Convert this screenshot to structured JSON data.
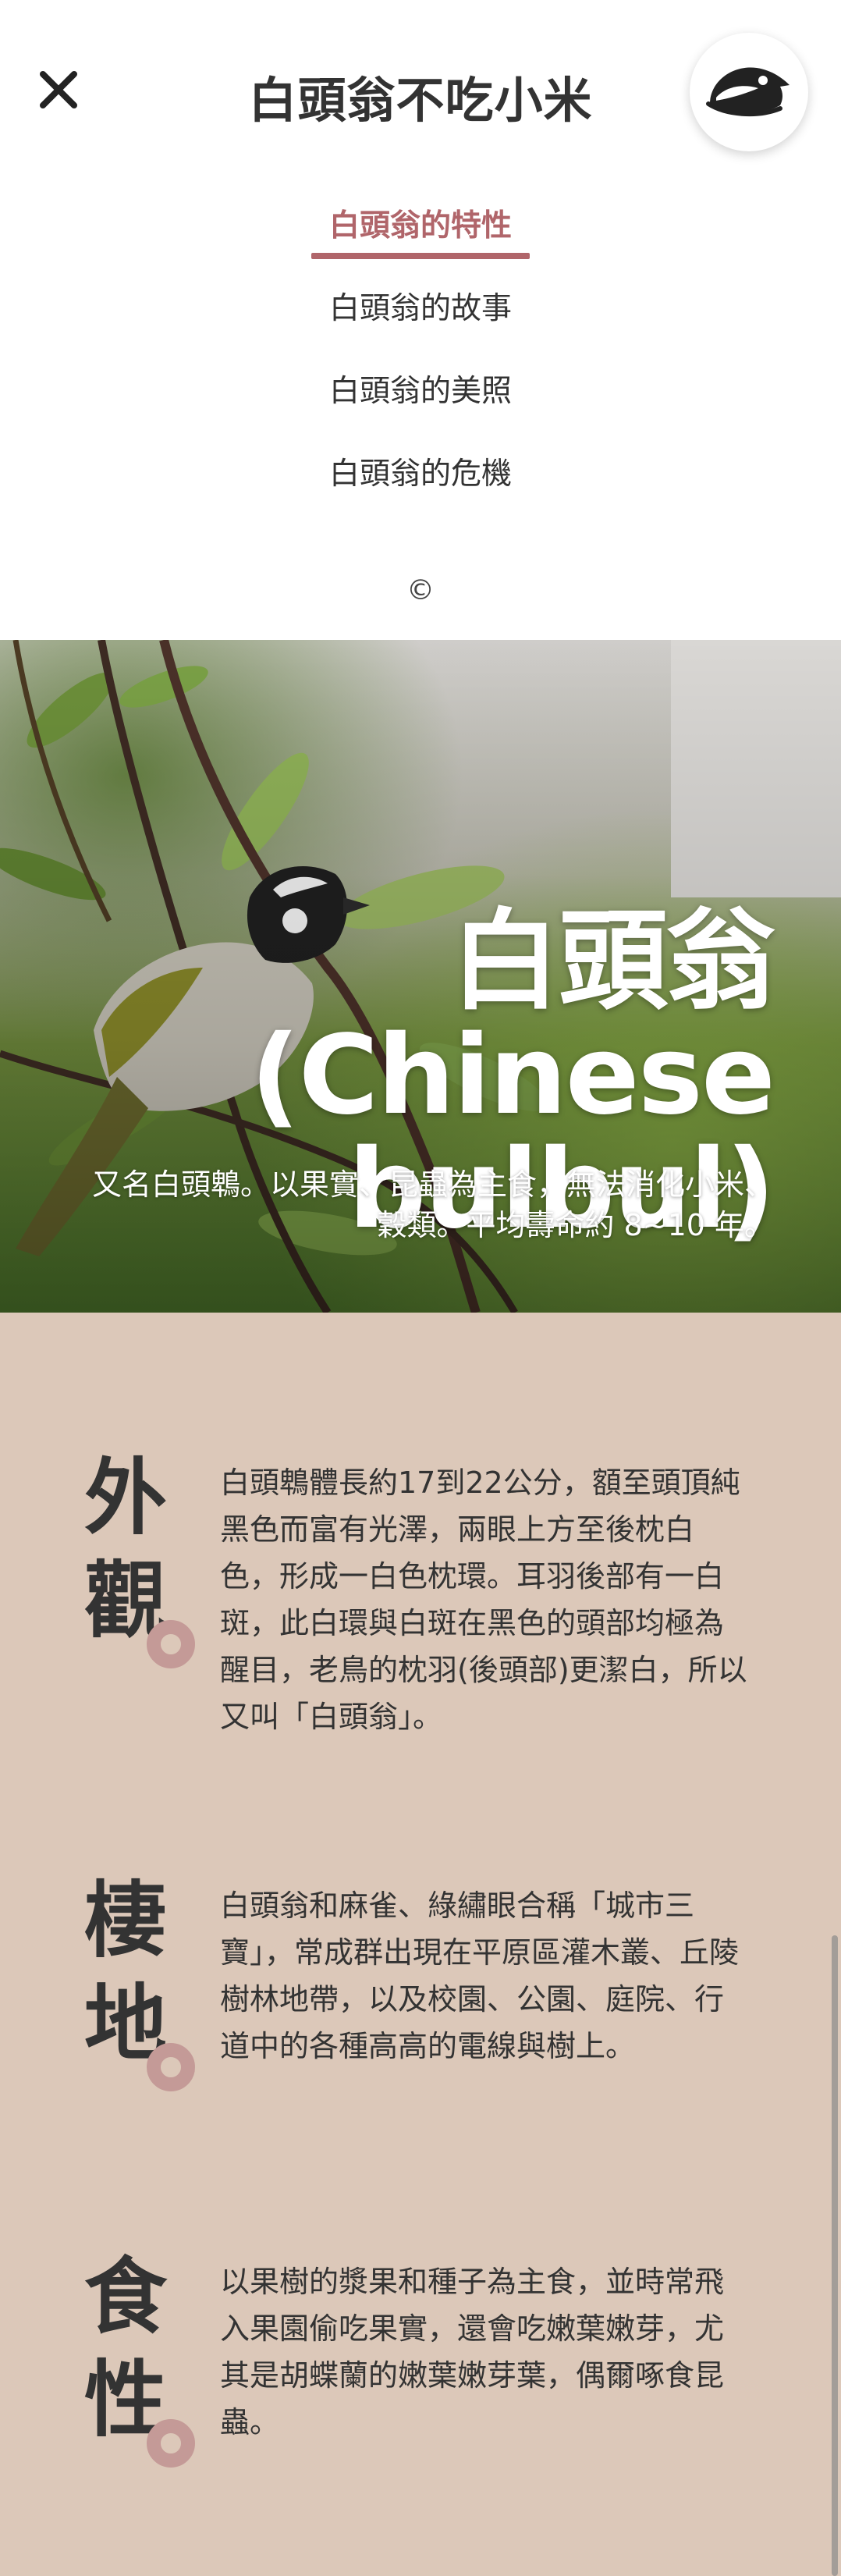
{
  "header": {
    "title": "白頭翁不吃小米",
    "close_icon": "close-icon",
    "logo_icon": "bird-logo-icon"
  },
  "nav": {
    "items": [
      {
        "label": "白頭翁的特性",
        "active": true
      },
      {
        "label": "白頭翁的故事",
        "active": false
      },
      {
        "label": "白頭翁的美照",
        "active": false
      },
      {
        "label": "白頭翁的危機",
        "active": false
      }
    ],
    "copyright": "©"
  },
  "hero": {
    "title": "白頭翁(Chinese bulbul)",
    "subtitle": "又名白頭鵯。以果實、昆蟲為主食，無法消化小米、穀類。平均壽命約 8~10 年。"
  },
  "sections": [
    {
      "heading": [
        "外",
        "觀"
      ],
      "body": "白頭鵯體長約17到22公分，額至頭頂純黑色而富有光澤，兩眼上方至後枕白色，形成一白色枕環。耳羽後部有一白斑，此白環與白斑在黑色的頭部均極為醒目，老鳥的枕羽(後頭部)更潔白，所以又叫「白頭翁」。"
    },
    {
      "heading": [
        "棲",
        "地"
      ],
      "body": "白頭翁和麻雀、綠繡眼合稱「城市三寶」，常成群出現在平原區灌木叢、丘陵樹林地帶，以及校園、公園、庭院、行道中的各種高高的電線與樹上。"
    },
    {
      "heading": [
        "食",
        "性"
      ],
      "body": "以果樹的漿果和種子為主食，並時常飛入果園偷吃果實，還會吃嫩葉嫩芽，尤其是胡蝶蘭的嫩葉嫩芽葉，偶爾啄食昆蟲。"
    }
  ],
  "colors": {
    "accent": "#b0656a",
    "content_bg": "#dcc8b9",
    "dot": "#c49a97",
    "text": "#333333"
  }
}
